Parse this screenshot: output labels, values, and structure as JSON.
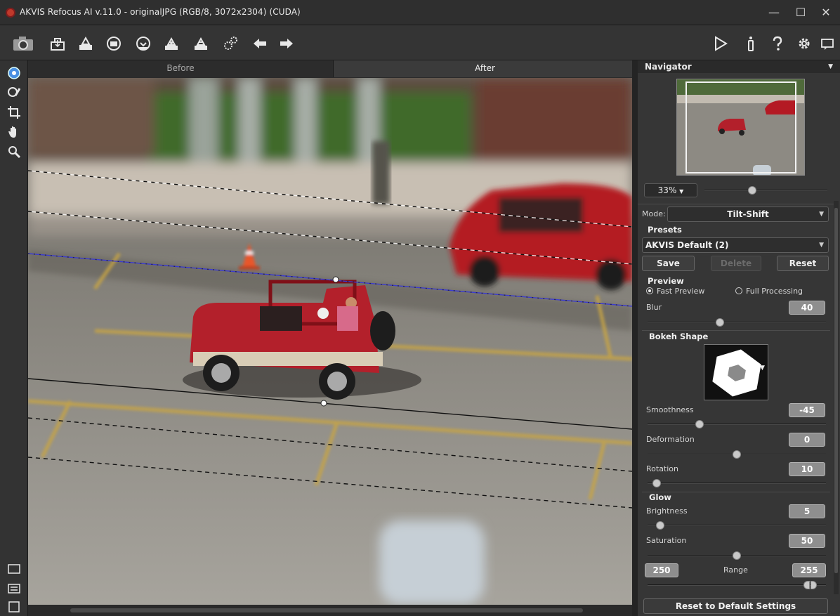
{
  "window": {
    "title": "AKVIS Refocus AI v.11.0 - originalJPG (RGB/8, 3072x2304) (CUDA)",
    "minimize": "—",
    "maximize": "☐",
    "close": "✕"
  },
  "toolbar": {
    "left_icons": [
      "camera-icon",
      "open-icon",
      "save-icon",
      "print-icon",
      "share-icon",
      "batch-icon",
      "plugin-icon",
      "gear-cluster-icon",
      "undo-arrow-icon",
      "redo-arrow-icon"
    ],
    "right_icons": [
      "run-icon",
      "info-icon",
      "help-icon",
      "settings-icon",
      "chat-icon"
    ]
  },
  "tools": [
    "focus-tool-icon",
    "brush-tool-icon",
    "crop-tool-icon",
    "hand-tool-icon",
    "zoom-tool-icon"
  ],
  "view_buttons": [
    "single-view-icon",
    "split-view-icon",
    "fullscreen-view-icon"
  ],
  "tabs": {
    "before": "Before",
    "after": "After"
  },
  "panel": {
    "navigator_title": "Navigator",
    "zoom_value": "33%",
    "zoom_slider_fraction": 0.38,
    "mode_label": "Mode:",
    "mode_value": "Tilt-Shift",
    "presets_label": "Presets",
    "preset_value": "AKVIS Default (2)",
    "save_button": "Save",
    "delete_button": "Delete",
    "reset_button": "Reset",
    "preview_label": "Preview",
    "fast_preview": "Fast Preview",
    "full_processing": "Full Processing",
    "fast_preview_selected": true,
    "blur_label": "Blur",
    "blur_value": "40",
    "blur_fraction": 0.4,
    "bokeh_label": "Bokeh Shape",
    "smoothness_label": "Smoothness",
    "smoothness_value": "-45",
    "smoothness_fraction": 0.28,
    "deformation_label": "Deformation",
    "deformation_value": "0",
    "deformation_fraction": 0.5,
    "rotation_label": "Rotation",
    "rotation_value": "10",
    "rotation_fraction": 0.03,
    "glow_label": "Glow",
    "brightness_label": "Brightness",
    "brightness_value": "5",
    "brightness_fraction": 0.05,
    "saturation_label": "Saturation",
    "saturation_value": "50",
    "saturation_fraction": 0.5,
    "range_label": "Range",
    "range_min": "250",
    "range_max": "255",
    "reset_defaults": "Reset to Default Settings"
  },
  "colors": {
    "accent": "#4a90e2",
    "panel_bg": "#363636",
    "value_box": "#8e8e8e"
  }
}
